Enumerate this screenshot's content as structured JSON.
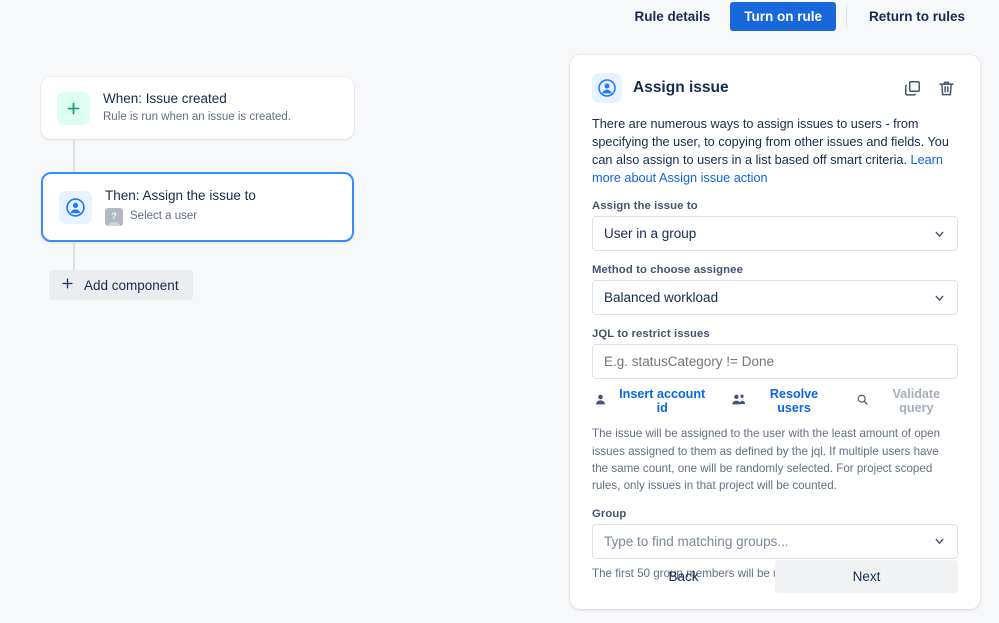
{
  "topbar": {
    "rule_details": "Rule details",
    "turn_on_rule": "Turn on rule",
    "return_to_rules": "Return to rules"
  },
  "canvas": {
    "trigger": {
      "icon": "plus-icon",
      "title": "When: Issue created",
      "subtitle": "Rule is run when an issue is created."
    },
    "action": {
      "icon": "user-circle-icon",
      "title": "Then: Assign the issue to",
      "avatar_glyph": "?",
      "subtitle": "Select a user"
    },
    "add_component": "Add component"
  },
  "panel": {
    "icon": "user-circle-icon",
    "title": "Assign issue",
    "copy_icon": "copy-icon",
    "delete_icon": "trash-icon",
    "description": "There are numerous ways to assign issues to users - from specifying the user, to copying from other issues and fields. You can also assign to users in a list based off smart criteria. ",
    "description_link": "Learn more about Assign issue action",
    "fields": {
      "assign_to": {
        "label": "Assign the issue to",
        "value": "User in a group"
      },
      "method": {
        "label": "Method to choose assignee",
        "value": "Balanced workload"
      },
      "jql": {
        "label": "JQL to restrict issues",
        "placeholder": "E.g. statusCategory != Done",
        "value": ""
      },
      "group": {
        "label": "Group",
        "placeholder": "Type to find matching groups...",
        "helper": "The first 50 group members will be used."
      }
    },
    "jql_links": {
      "insert_account_id": "Insert account id",
      "resolve_users": "Resolve users",
      "validate_query": "Validate query"
    },
    "jql_helper": "The issue will be assigned to the user with the least amount of open issues assigned to them as defined by the jql. If multiple users have the same count, one will be randomly selected. For project scoped rules, only issues in that project will be counted.",
    "footer": {
      "back": "Back",
      "next": "Next"
    }
  },
  "colors": {
    "primary_blue": "#1868db",
    "link_blue": "#0c66e4",
    "selected_border": "#388bff",
    "text_dark": "#172b4d",
    "text_muted": "#626f86",
    "page_bg": "#f7f8f9"
  }
}
